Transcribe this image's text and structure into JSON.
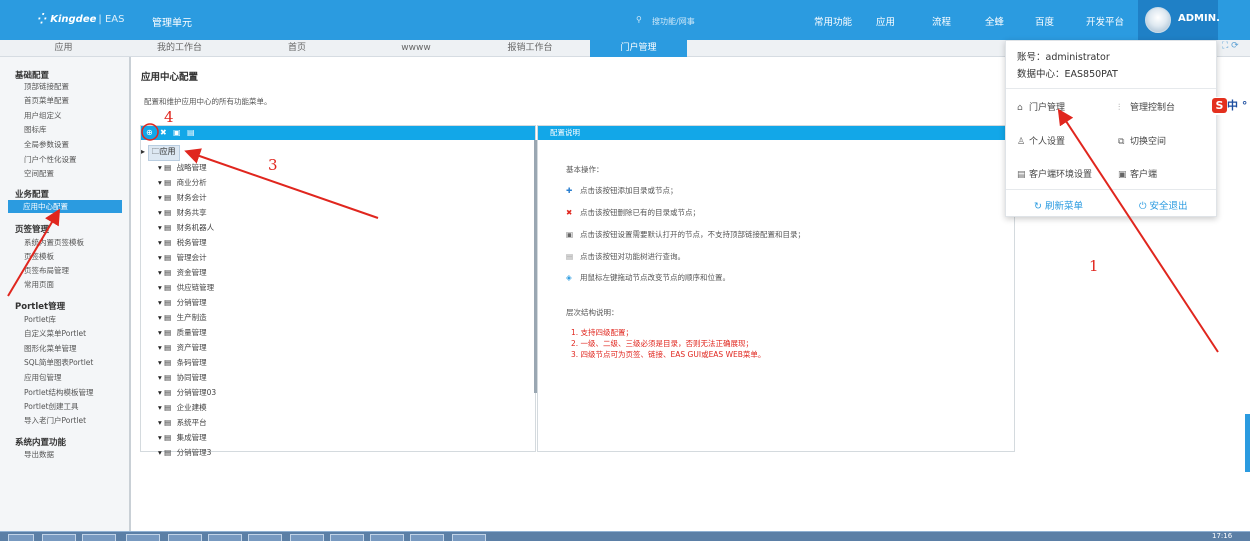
{
  "topbar": {
    "logo": "Kingdee",
    "logo_suffix": "| EAS",
    "app_title": "管理单元",
    "search_placeholder": "搜功能/网事",
    "nav": [
      "常用功能",
      "应用",
      "流程",
      "全蜂",
      "百度",
      "开发平台"
    ],
    "user": "ADMIN."
  },
  "tabs": [
    "应用",
    "我的工作台",
    "首页",
    "wwww",
    "报销工作台",
    "门户管理"
  ],
  "active_tab": "门户管理",
  "leftnav": {
    "groups": [
      {
        "title": "基础配置",
        "items": [
          "顶部链接配置",
          "首页菜单配置",
          "用户组定义",
          "图标库",
          "全局参数设置",
          "门户个性化设置",
          "空间配置"
        ]
      },
      {
        "title": "业务配置",
        "items": [
          "应用中心配置"
        ]
      },
      {
        "title": "页签管理",
        "items": [
          "系统内置页签模板",
          "页签模板",
          "页签布局管理",
          "常用页面"
        ]
      },
      {
        "title": "Portlet管理",
        "items": [
          "Portlet库",
          "自定义菜单Portlet",
          "图形化菜单管理",
          "SQL简单图表Portlet",
          "应用包管理",
          "Portlet结构模板管理",
          "Portlet创建工具",
          "导入老门户Portlet"
        ]
      },
      {
        "title": "系统内置功能",
        "items": [
          "导出数据"
        ]
      }
    ],
    "selected": "应用中心配置"
  },
  "page": {
    "title": "应用中心配置",
    "description": "配置和维护应用中心的所有功能菜单。"
  },
  "tree": {
    "root": "应用",
    "nodes": [
      "战略管理",
      "商业分析",
      "财务会计",
      "财务共享",
      "财务机器人",
      "税务管理",
      "管理会计",
      "资金管理",
      "供应链管理",
      "分销管理",
      "生产制造",
      "质量管理",
      "资产管理",
      "条码管理",
      "协同管理",
      "分销管理03",
      "企业建模",
      "系统平台",
      "集成管理",
      "分销管理3"
    ]
  },
  "help": {
    "header": "配置说明",
    "basic_title": "基本操作：",
    "ops": [
      {
        "icon": "✚",
        "color": "#2b7fd0",
        "text": "点击该按钮添加目录或节点；"
      },
      {
        "icon": "✖",
        "color": "#e0261e",
        "text": "点击该按钮删除已有的目录或节点；"
      },
      {
        "icon": "▣",
        "color": "#666666",
        "text": "点击该按钮设置需要默认打开的节点，不支持顶部链接配置和目录；"
      },
      {
        "icon": "▤",
        "color": "#888888",
        "text": "点击该按钮对功能树进行查询。"
      },
      {
        "icon": "◈",
        "color": "#2b9be0",
        "text": "用鼠标左键拖动节点改变节点的顺序和位置。"
      }
    ],
    "struct_title": "层次结构说明：",
    "rules": [
      "1. 支持四级配置；",
      "2. 一级、二级、三级必须是目录，否则无法正确展现；",
      "3. 四级节点可为页签、链接、EAS GUI或EAS WEB菜单。"
    ]
  },
  "dropdown": {
    "account": "账号：administrator",
    "datacenter": "数据中心：EAS850PAT",
    "items": [
      {
        "icon": "home-gear-icon",
        "label": "门户管理"
      },
      {
        "icon": "sliders-icon",
        "label": "管理控制台"
      },
      {
        "icon": "person-icon",
        "label": "个人设置"
      },
      {
        "icon": "switch-space-icon",
        "label": "切换空间"
      },
      {
        "icon": "client-env-icon",
        "label": "客户端环境设置"
      },
      {
        "icon": "client-icon",
        "label": "客户端"
      }
    ],
    "refresh": "刷新菜单",
    "logout": "安全退出"
  },
  "ime": {
    "label": "中",
    "badge": "S"
  },
  "taskbar": {
    "clock": "17:16"
  },
  "annotations": [
    "1",
    "3",
    "4"
  ],
  "colors": {
    "primary": "#2b9be0",
    "toolbar": "#12a7e8",
    "annotation": "#e0261e"
  }
}
